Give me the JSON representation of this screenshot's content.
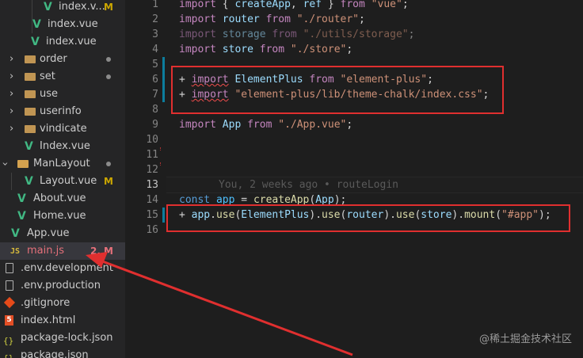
{
  "explorer": {
    "items": [
      {
        "label": "index.v...",
        "badge": "M",
        "kind": "vue"
      },
      {
        "label": "index.vue",
        "badge": "",
        "kind": "vue"
      },
      {
        "label": "index.vue",
        "badge": "",
        "kind": "vue"
      },
      {
        "label": "order",
        "badge": "dot",
        "kind": "folder"
      },
      {
        "label": "set",
        "badge": "dot",
        "kind": "folder"
      },
      {
        "label": "use",
        "badge": "",
        "kind": "folder"
      },
      {
        "label": "userinfo",
        "badge": "",
        "kind": "folder"
      },
      {
        "label": "vindicate",
        "badge": "",
        "kind": "folder"
      },
      {
        "label": "Index.vue",
        "badge": "",
        "kind": "vue"
      },
      {
        "label": "ManLayout",
        "badge": "dot",
        "kind": "folder-open"
      },
      {
        "label": "Layout.vue",
        "badge": "M",
        "kind": "vue"
      },
      {
        "label": "About.vue",
        "badge": "",
        "kind": "vue"
      },
      {
        "label": "Home.vue",
        "badge": "",
        "kind": "vue"
      },
      {
        "label": "App.vue",
        "badge": "",
        "kind": "vue"
      },
      {
        "label": "main.js",
        "badge": "2, M",
        "kind": "js"
      },
      {
        "label": ".env.development",
        "badge": "",
        "kind": "file"
      },
      {
        "label": ".env.production",
        "badge": "",
        "kind": "file"
      },
      {
        "label": ".gitignore",
        "badge": "",
        "kind": "git"
      },
      {
        "label": "index.html",
        "badge": "",
        "kind": "html"
      },
      {
        "label": "package-lock.json",
        "badge": "",
        "kind": "json"
      },
      {
        "label": "package.json",
        "badge": "",
        "kind": "json"
      }
    ],
    "icon_labels": {
      "js": "JS",
      "html": "5",
      "json": "{}"
    }
  },
  "editor": {
    "line_numbers": [
      "1",
      "2",
      "3",
      "4",
      "5",
      "6",
      "7",
      "8",
      "9",
      "10",
      "11",
      "12",
      "13",
      "14",
      "15",
      "16"
    ],
    "lines": {
      "l1": {
        "kw1": "import",
        "p1": " { ",
        "v1": "createApp",
        "p2": ", ",
        "v2": "ref",
        "p3": " } ",
        "kw2": "from",
        "p4": " ",
        "s": "\"vue\"",
        "p5": ";"
      },
      "l2": {
        "kw1": "import",
        "p1": " ",
        "v1": "router",
        "p2": " ",
        "kw2": "from",
        "p3": " ",
        "s": "\"./router\"",
        "p4": ";"
      },
      "l3": {
        "kw1": "import",
        "p1": " ",
        "v1": "storage",
        "p2": " ",
        "kw2": "from",
        "p3": " ",
        "s": "\"./utils/storage\"",
        "p4": ";"
      },
      "l4": {
        "kw1": "import",
        "p1": " ",
        "v1": "store",
        "p2": " ",
        "kw2": "from",
        "p3": " ",
        "s": "\"./store\"",
        "p4": ";"
      },
      "l6": {
        "plus": "+ ",
        "kw1": "import",
        "p1": " ",
        "v1": "ElementPlus",
        "p2": " ",
        "kw2": "from",
        "p3": " ",
        "s": "\"element-plus\"",
        "p4": ";"
      },
      "l7": {
        "plus": "+ ",
        "kw1": "import",
        "p1": " ",
        "s": "\"element-plus/lib/theme-chalk/index.css\"",
        "p2": ";"
      },
      "l9": {
        "kw1": "import",
        "p1": " ",
        "v1": "App",
        "p2": " ",
        "kw2": "from",
        "p3": " ",
        "s": "\"./App.vue\"",
        "p4": ";"
      },
      "l14": {
        "kw1": "const",
        "p1": " ",
        "v1": "app",
        "p2": " = ",
        "f1": "createApp",
        "p3": "(",
        "v2": "App",
        "p4": ");"
      },
      "l15": {
        "plus": "+ ",
        "v1": "app",
        "p1": ".",
        "f1": "use",
        "p2": "(",
        "v2": "ElementPlus",
        "p3": ").",
        "f2": "use",
        "p4": "(",
        "v3": "router",
        "p5": ").",
        "f3": "use",
        "p6": "(",
        "v4": "store",
        "p7": ").",
        "f4": "mount",
        "p8": "(",
        "s": "\"#app\"",
        "p9": ");"
      }
    },
    "blame": "You, 2 weeks ago • routeLogin"
  },
  "watermark": "@稀土掘金技术社区",
  "colors": {
    "highlight_box": "#e02f2f",
    "arrow": "#e02f2f"
  }
}
